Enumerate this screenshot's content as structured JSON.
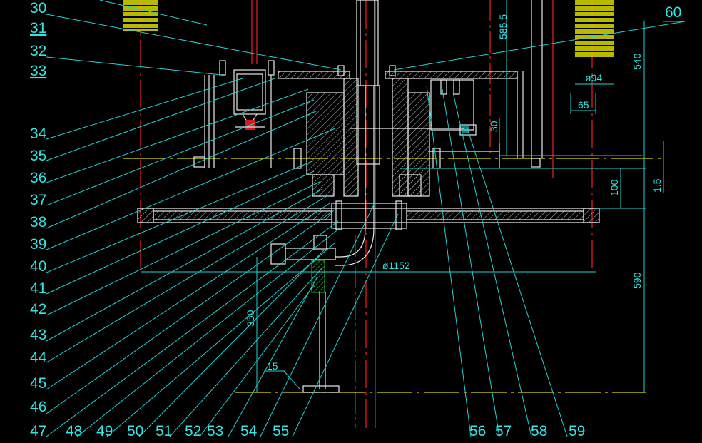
{
  "part_labels": [
    "30",
    "31",
    "32",
    "33",
    "34",
    "35",
    "36",
    "37",
    "38",
    "39",
    "40",
    "41",
    "42",
    "43",
    "44",
    "45",
    "46",
    "47",
    "48",
    "49",
    "50",
    "51",
    "52",
    "53",
    "54",
    "55",
    "56",
    "57",
    "58",
    "59",
    "60"
  ],
  "dimensions": {
    "d585_5": "585.5",
    "d540": "540",
    "d94": "ø94",
    "d65": "65",
    "d30": "30",
    "d100": "100",
    "d1_5": "1.5",
    "d1152": "ø1152",
    "d590": "590",
    "d350": "350",
    "d15": "15"
  },
  "colors": {
    "background": "#000000",
    "leader": "#1fd4d4",
    "outline": "#e8e8e8",
    "centerline": "#d41a1a",
    "baseline": "#d8d800"
  }
}
